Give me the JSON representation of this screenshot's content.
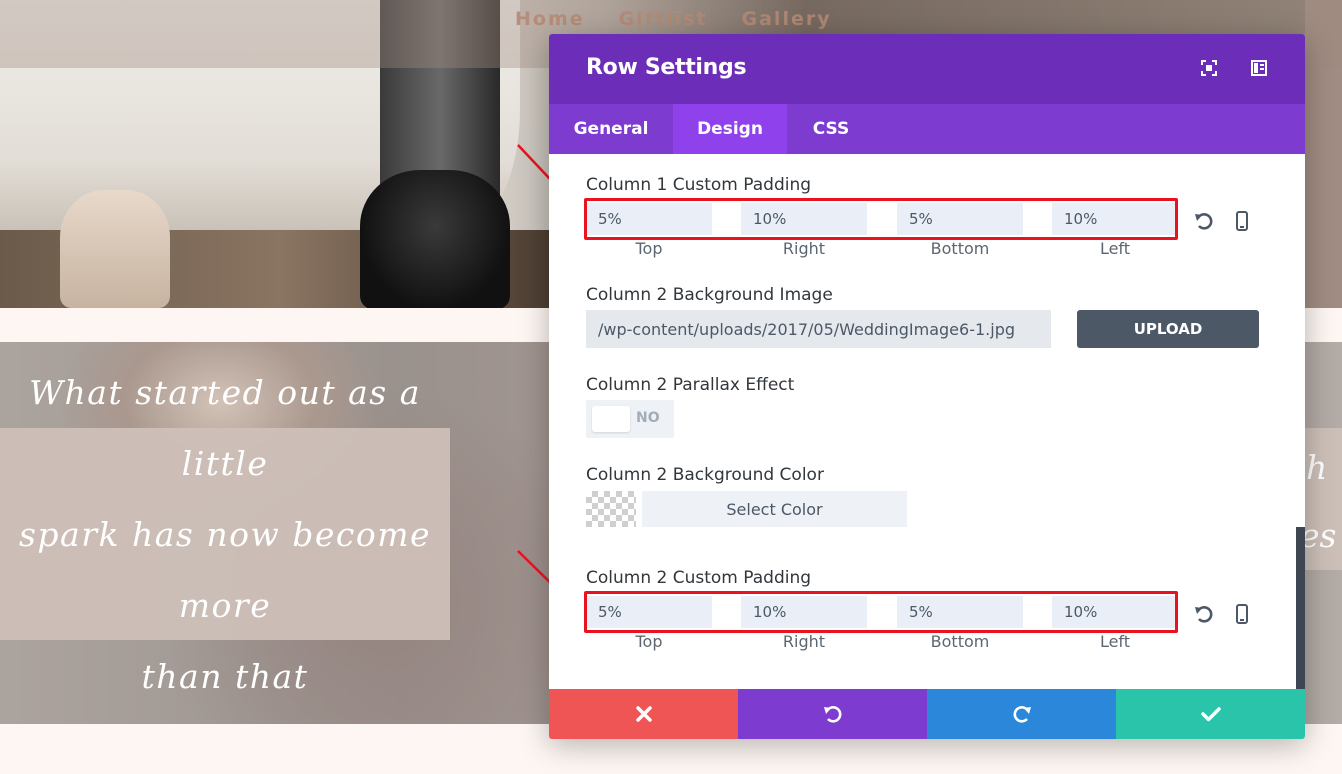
{
  "website": {
    "nav": [
      "Home",
      "Giftlist",
      "Gallery"
    ],
    "quote_lines": [
      "What started out as a little",
      "spark has now become more",
      "than that"
    ],
    "quote_right_fragments": [
      "h",
      "es"
    ]
  },
  "modal": {
    "title": "Row Settings",
    "header_icons": [
      "expand-icon",
      "sidebar-layout-icon"
    ],
    "tabs": [
      {
        "label": "General",
        "active": false
      },
      {
        "label": "Design",
        "active": true
      },
      {
        "label": "CSS",
        "active": false
      }
    ],
    "column1_padding": {
      "label": "Column 1 Custom Padding",
      "values": [
        "5%",
        "10%",
        "5%",
        "10%"
      ],
      "captions": [
        "Top",
        "Right",
        "Bottom",
        "Left"
      ]
    },
    "column2_bg_image": {
      "label": "Column 2 Background Image",
      "value": "/wp-content/uploads/2017/05/WeddingImage6-1.jpg",
      "button": "UPLOAD"
    },
    "column2_parallax": {
      "label": "Column 2 Parallax Effect",
      "state": "NO"
    },
    "column2_bg_color": {
      "label": "Column 2 Background Color",
      "button": "Select Color"
    },
    "column2_padding": {
      "label": "Column 2 Custom Padding",
      "values": [
        "5%",
        "10%",
        "5%",
        "10%"
      ],
      "captions": [
        "Top",
        "Right",
        "Bottom",
        "Left"
      ]
    },
    "footer_icons": [
      "close-icon",
      "undo-icon",
      "redo-icon",
      "check-icon"
    ]
  },
  "colors": {
    "header": "#6c2eb9",
    "tabs": "#7e3bd0",
    "active_tab": "#8f42ec",
    "cancel": "#ef5555",
    "undo": "#7e3bd0",
    "redo": "#2b87da",
    "save": "#29c4a9",
    "highlight": "#e8131f"
  }
}
